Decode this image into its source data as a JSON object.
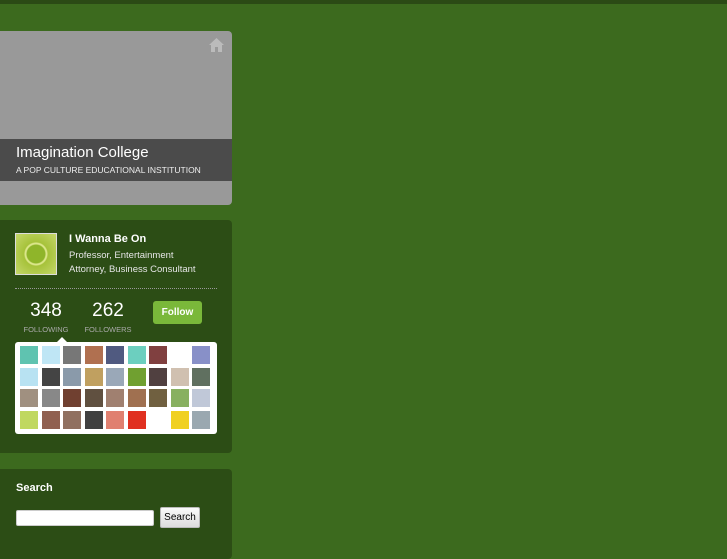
{
  "header": {
    "title": "Imagination College",
    "subtitle": "A POP CULTURE EDUCATIONAL INSTITUTION"
  },
  "profile": {
    "name": "I Wanna Be On",
    "description": "Professor, Entertainment Attorney, Business Consultant",
    "following_count": "348",
    "following_label": "FOLLOWING",
    "followers_count": "262",
    "followers_label": "FOLLOWERS",
    "follow_button": "Follow"
  },
  "following_thumb_colors": [
    "#5fc3b0",
    "#bfe6f5",
    "#777",
    "#b07050",
    "#505a80",
    "#6ccfbf",
    "#804040",
    "#fff",
    "#8890c8",
    "#b8e2f2",
    "#444",
    "#8a9aaa",
    "#c0a060",
    "#9aa8b8",
    "#70a030",
    "#504040",
    "#d0c0b0",
    "#607060",
    "#a09080",
    "#888",
    "#704030",
    "#605040",
    "#a08070",
    "#a07050",
    "#706040",
    "#88b060",
    "#c0c8d8",
    "#c0d860",
    "#906050",
    "#907060",
    "#404040",
    "#e08070",
    "#e03020",
    "#fff",
    "#f0d020",
    "#9aa8b0"
  ],
  "search": {
    "label": "Search",
    "input_value": "",
    "button": "Search"
  }
}
